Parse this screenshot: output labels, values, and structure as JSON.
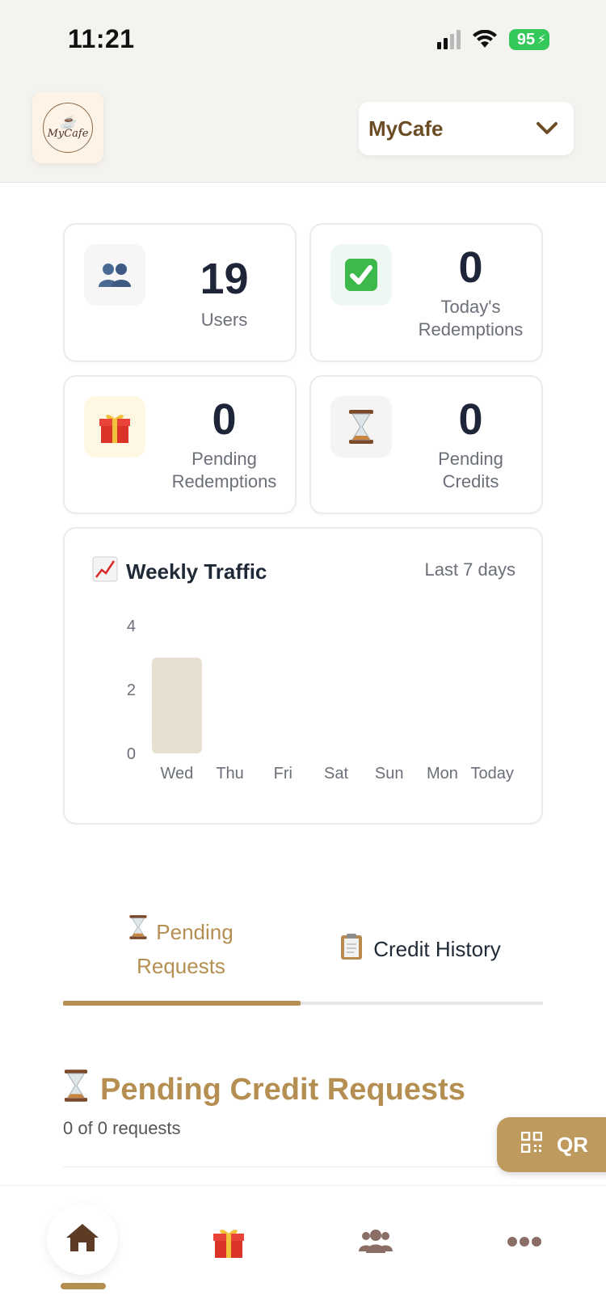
{
  "status_bar": {
    "time": "11:21",
    "battery": "95"
  },
  "header": {
    "logo_text": "MyCafe",
    "cafe_selector": "MyCafe"
  },
  "stats": {
    "users": {
      "value": "19",
      "label": "Users"
    },
    "todays_redemptions": {
      "value": "0",
      "label_line1": "Today's",
      "label_line2": "Redemptions"
    },
    "pending_redemptions": {
      "value": "0",
      "label_line1": "Pending",
      "label_line2": "Redemptions"
    },
    "pending_credits": {
      "value": "0",
      "label_line1": "Pending",
      "label_line2": "Credits"
    }
  },
  "traffic": {
    "title": "Weekly Traffic",
    "range": "Last 7 days"
  },
  "chart_data": {
    "type": "bar",
    "categories": [
      "Wed",
      "Thu",
      "Fri",
      "Sat",
      "Sun",
      "Mon",
      "Today"
    ],
    "values": [
      3,
      0,
      0,
      0,
      0,
      0,
      0
    ],
    "yticks": [
      0,
      2,
      4
    ],
    "ylim": [
      0,
      4
    ],
    "grid": false,
    "bar_color": "#e8dfd3"
  },
  "tabs": {
    "pending_line1": "Pending",
    "pending_line2": "Requests",
    "history": "Credit History"
  },
  "section": {
    "title": "Pending Credit Requests",
    "count": "0 of 0 requests"
  },
  "qr_button": {
    "label": "QR"
  },
  "colors": {
    "accent": "#b58f52",
    "header_bg": "#f5f3ef",
    "battery": "#34c759",
    "qr_bg": "#bf9a5f"
  }
}
